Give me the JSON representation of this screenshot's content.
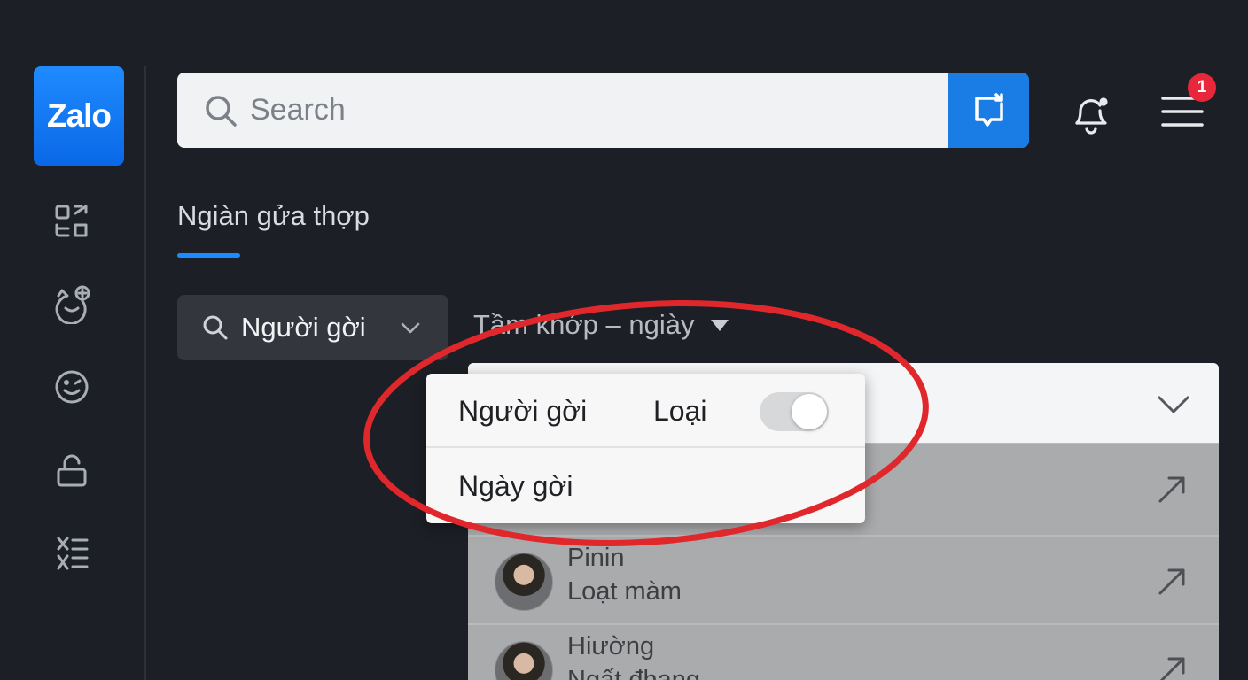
{
  "app": {
    "logo_text": "Zalo"
  },
  "colors": {
    "accent": "#1a7de5",
    "badge": "#e8283a",
    "annotation": "#e0282c"
  },
  "sidebar": {
    "items": [
      {
        "icon": "qr-scan-icon"
      },
      {
        "icon": "cat-add-icon"
      },
      {
        "icon": "emoji-icon"
      },
      {
        "icon": "lock-icon"
      },
      {
        "icon": "list-icon"
      }
    ]
  },
  "search": {
    "placeholder": "Search"
  },
  "header": {
    "notification_badge": "1"
  },
  "page": {
    "title": "Ngiàn gửa thợp"
  },
  "filter": {
    "chip_label": "Người gời",
    "sort_label": "Tầm khớp – ngiày"
  },
  "dropdown": {
    "row1_label": "Người gời",
    "row1_type": "Loại",
    "toggle_on": true,
    "row2_label": "Ngày gời"
  },
  "results": [
    {
      "name": "Pinin",
      "subtitle": "Loạt màm"
    },
    {
      "name": "Hiường",
      "subtitle": "Ngất đhang"
    }
  ]
}
